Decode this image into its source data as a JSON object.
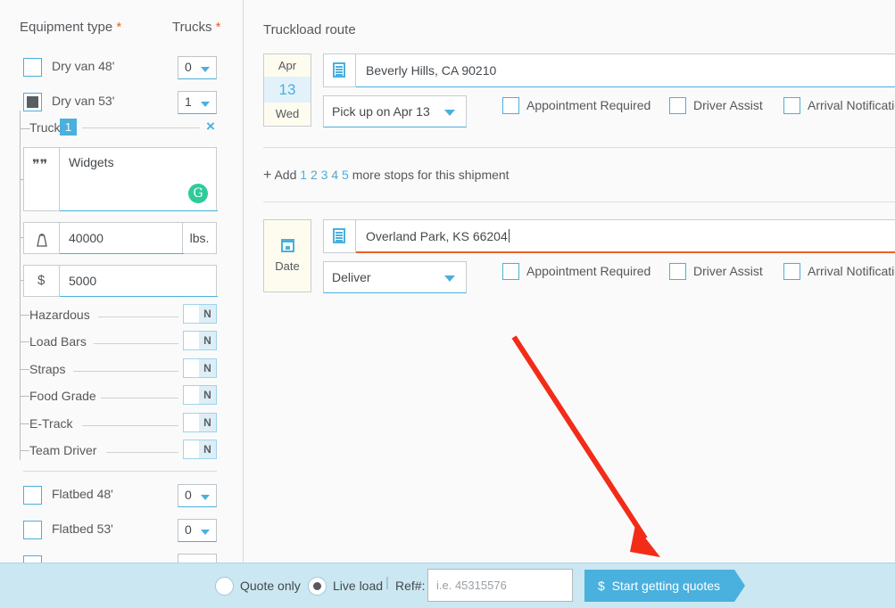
{
  "left_panel": {
    "header": {
      "equipment_type": "Equipment type",
      "trucks": "Trucks",
      "required_marker": "*"
    },
    "equipment_rows": [
      {
        "label": "Dry van 48'",
        "checked": false,
        "qty": "0"
      },
      {
        "label": "Dry van 53'",
        "checked": true,
        "qty": "1"
      },
      {
        "label": "Flatbed 48'",
        "checked": false,
        "qty": "0"
      },
      {
        "label": "Flatbed 53'",
        "checked": false,
        "qty": "0"
      }
    ],
    "truck_block": {
      "label": "Truck",
      "badge": "1",
      "close_icon": "×",
      "commodity": {
        "icon": "quote-icon",
        "value": "Widgets",
        "badge": "G"
      },
      "weight": {
        "icon": "weight-icon",
        "value": "40000",
        "unit": "lbs."
      },
      "price": {
        "icon": "dollar-icon",
        "value": "5000"
      },
      "options": [
        {
          "label": "Hazardous",
          "state": "N"
        },
        {
          "label": "Load Bars",
          "state": "N"
        },
        {
          "label": "Straps",
          "state": "N"
        },
        {
          "label": "Food Grade",
          "state": "N"
        },
        {
          "label": "E-Track",
          "state": "N"
        },
        {
          "label": "Team Driver",
          "state": "N"
        }
      ]
    }
  },
  "right_panel": {
    "title": "Truckload route",
    "stops": [
      {
        "date": {
          "month": "Apr",
          "day": "13",
          "weekday": "Wed",
          "empty": false
        },
        "address": "Beverly Hills, CA 90210",
        "focused": false,
        "action": "Pick up on Apr 13",
        "checkboxes": [
          {
            "label": "Appointment Required",
            "checked": false
          },
          {
            "label": "Driver Assist",
            "checked": false
          },
          {
            "label": "Arrival Notification",
            "checked": false
          }
        ]
      },
      {
        "date": {
          "month": "",
          "day": "",
          "weekday": "",
          "empty": true,
          "placeholder": "Date"
        },
        "address": "Overland Park, KS 66204",
        "focused": true,
        "action": "Deliver",
        "checkboxes": [
          {
            "label": "Appointment Required",
            "checked": false
          },
          {
            "label": "Driver Assist",
            "checked": false
          },
          {
            "label": "Arrival Notification",
            "checked": false
          }
        ]
      }
    ],
    "add_stops": {
      "plus": "+",
      "prefix": "Add",
      "numbers": [
        "1",
        "2",
        "3",
        "4",
        "5"
      ],
      "suffix": "more stops for this shipment"
    }
  },
  "bottom_bar": {
    "quote_only": {
      "label": "Quote only",
      "selected": false
    },
    "live_load": {
      "label": "Live load",
      "selected": true
    },
    "separator": "|",
    "ref_label": "Ref#:",
    "ref_placeholder": "i.e. 45315576",
    "ref_value": "",
    "start_button": {
      "icon": "$",
      "label": "Start getting quotes"
    }
  },
  "annotation": {
    "type": "arrow",
    "color": "#f22c18",
    "points_to": "start-getting-quotes-button"
  },
  "colors": {
    "accent_blue": "#4ab0dd",
    "required_orange": "#e8622a",
    "focus_orange": "#e8622a",
    "green_badge": "#2ecc9a",
    "bottom_bar_bg": "#cbe7f2",
    "date_cream": "#fdfcef",
    "date_day_bg": "#e3f2fa",
    "arrow_red": "#f22c18"
  }
}
